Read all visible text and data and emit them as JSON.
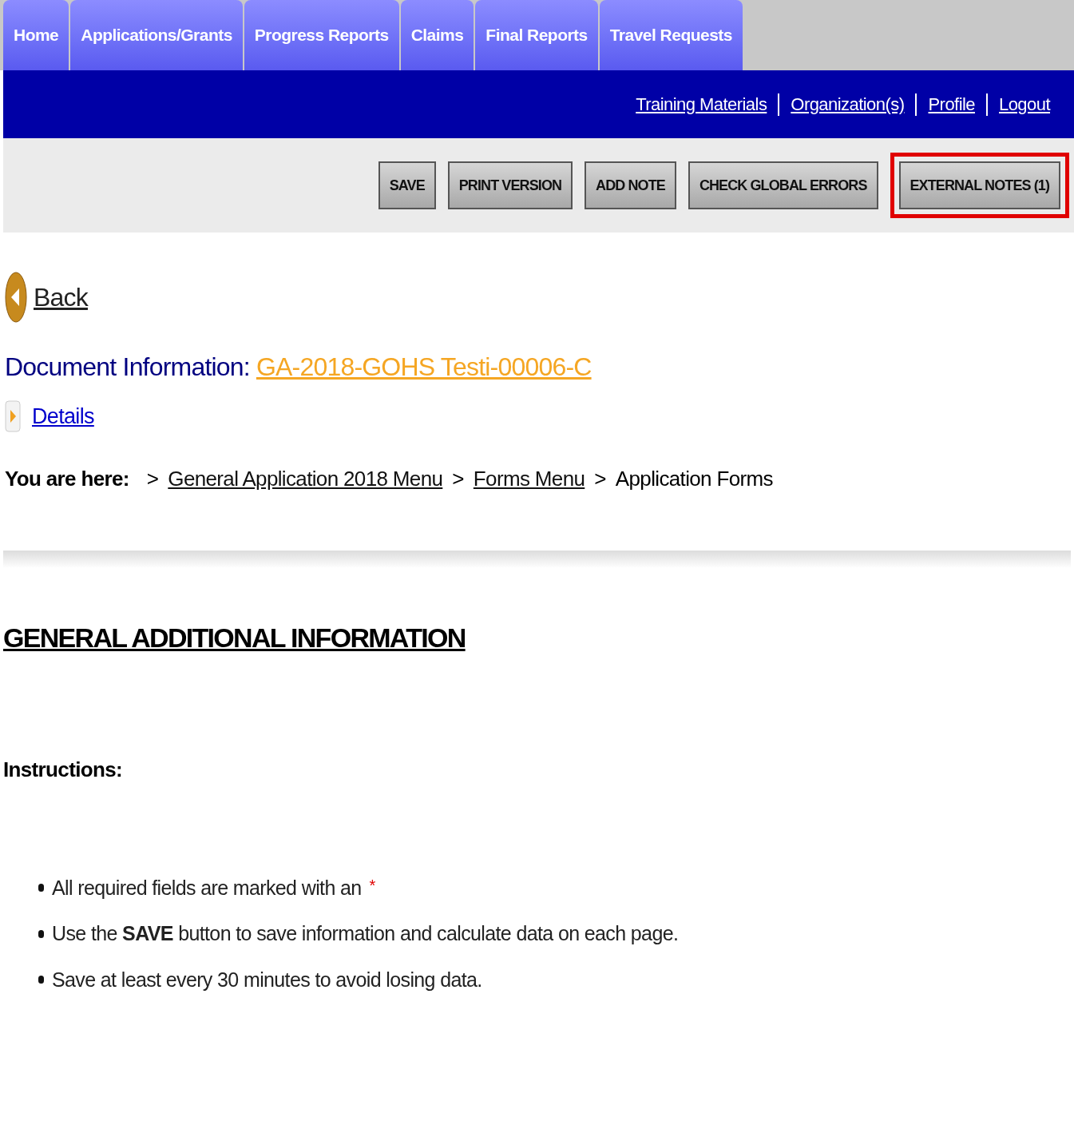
{
  "tabs": [
    {
      "label": "Home"
    },
    {
      "label": "Applications/Grants"
    },
    {
      "label": "Progress Reports"
    },
    {
      "label": "Claims"
    },
    {
      "label": "Final Reports"
    },
    {
      "label": "Travel Requests"
    }
  ],
  "top_links": [
    "Training Materials",
    "Organization(s)",
    "Profile",
    "Logout"
  ],
  "toolbar": [
    {
      "label": "SAVE",
      "highlighted": false
    },
    {
      "label": "PRINT VERSION",
      "highlighted": false
    },
    {
      "label": "ADD NOTE",
      "highlighted": false
    },
    {
      "label": "CHECK GLOBAL ERRORS",
      "highlighted": false
    },
    {
      "label": "EXTERNAL NOTES (1)",
      "highlighted": true
    }
  ],
  "back": "Back",
  "document": {
    "label": "Document Information:",
    "value": "GA-2018-GOHS Testi-00006-C"
  },
  "details": "Details",
  "breadcrumb": {
    "label": "You are here:",
    "separator": ">",
    "links": [
      "General Application 2018 Menu",
      "Forms Menu"
    ],
    "current": "Application Forms"
  },
  "section_title": "GENERAL ADDITIONAL INFORMATION",
  "instructions": {
    "title": "Instructions:",
    "items": [
      {
        "text": "All required fields are marked with an",
        "required_mark": "*"
      },
      {
        "text": "Use the **SAVE** button to save information and calculate data on each page."
      },
      {
        "text": "Save at least every 30 minutes to avoid losing data."
      }
    ]
  }
}
